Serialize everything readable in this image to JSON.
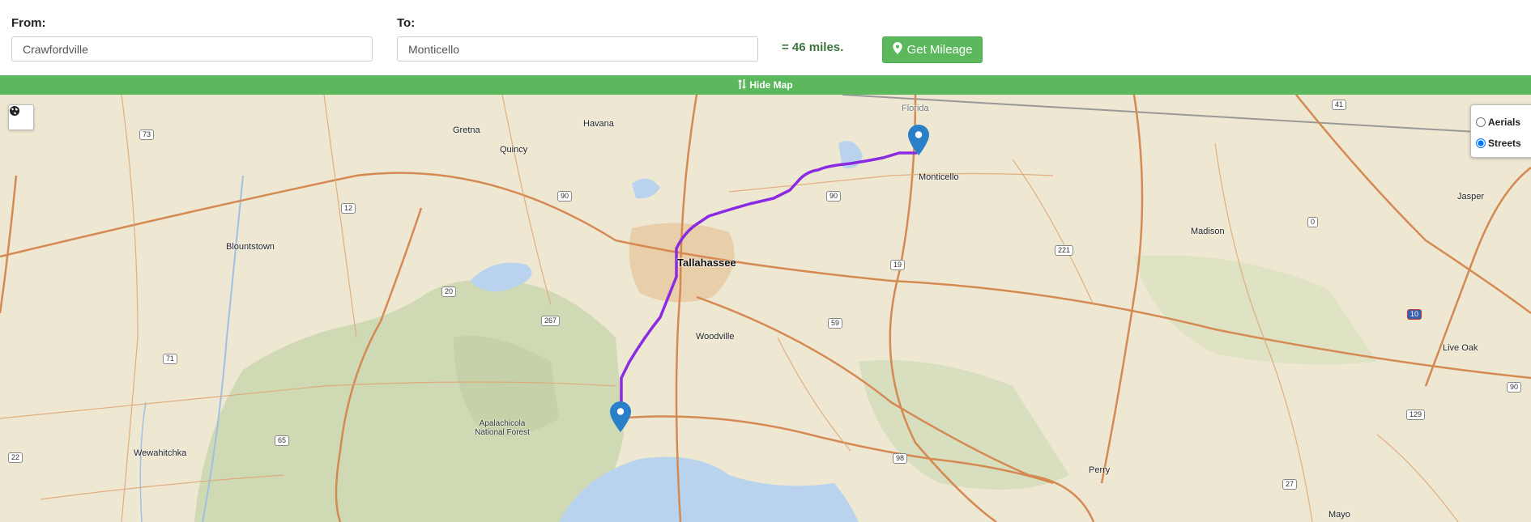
{
  "form": {
    "from_label": "From:",
    "from_value": "Crawfordville",
    "to_label": "To:",
    "to_value": "Monticello",
    "result_text": "= 46 miles.",
    "get_mileage_label": "Get Mileage"
  },
  "toggle_bar": {
    "label": "Hide Map",
    "icon": "sort-arrows-icon"
  },
  "map": {
    "layer_options": [
      {
        "label": "Aerials",
        "selected": false
      },
      {
        "label": "Streets",
        "selected": true
      }
    ],
    "places": {
      "gretna": "Gretna",
      "havana": "Havana",
      "quincy": "Quincy",
      "florida": "Florida",
      "monticello": "Monticello",
      "jasper": "Jasper",
      "blountstown": "Blountstown",
      "madison": "Madison",
      "tallahassee": "Tallahassee",
      "woodville": "Woodville",
      "live_oak": "Live Oak",
      "apalachicola_forest": "Apalachicola National Forest",
      "wewahitchka": "Wewahitchka",
      "perry": "Perry",
      "mayo": "Mayo"
    },
    "shields": [
      "73",
      "12",
      "90",
      "90",
      "221",
      "41",
      "0",
      "20",
      "267",
      "71",
      "65",
      "19",
      "59",
      "98",
      "10",
      "90",
      "129",
      "27",
      "22"
    ],
    "route_color": "#8a2be2",
    "marker_color": "#2a7fc9"
  }
}
